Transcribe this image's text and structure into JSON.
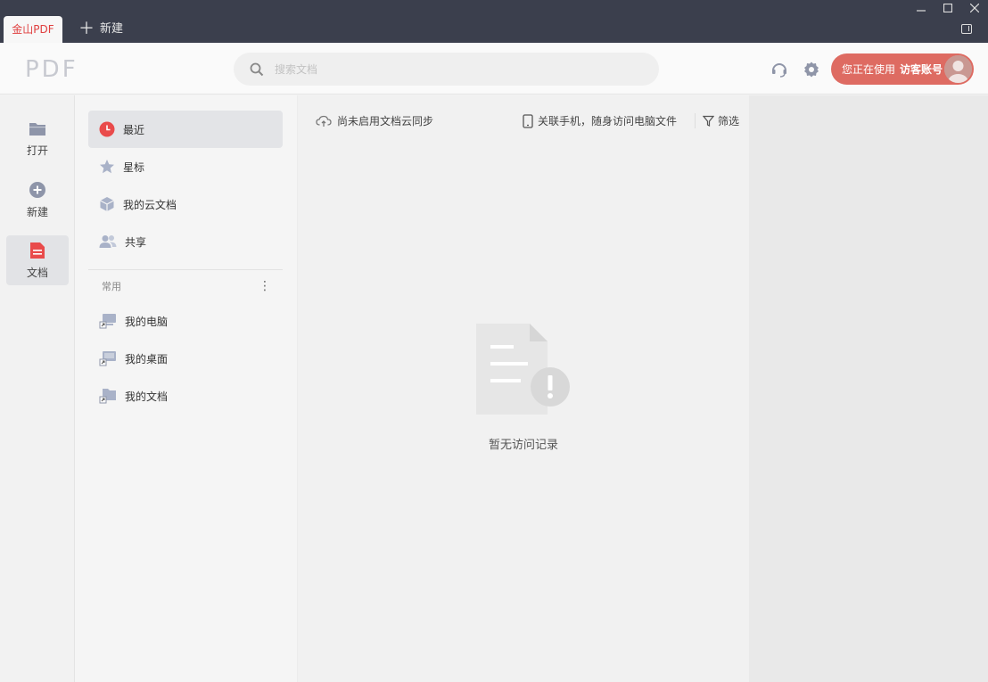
{
  "tabs": {
    "active_label": "金山PDF",
    "new_label": "新建"
  },
  "header": {
    "logo": "PDF",
    "search_placeholder": "搜索文档",
    "account_prefix": "您正在使用",
    "account_name": "访客账号"
  },
  "rail": {
    "items": [
      {
        "label": "打开",
        "icon": "folder-icon"
      },
      {
        "label": "新建",
        "icon": "plus-circle-icon"
      },
      {
        "label": "文档",
        "icon": "document-icon",
        "active": true
      }
    ]
  },
  "nav": {
    "items": [
      {
        "label": "最近",
        "icon": "clock-icon",
        "active": true
      },
      {
        "label": "星标",
        "icon": "star-icon"
      },
      {
        "label": "我的云文档",
        "icon": "cloud-box-icon"
      },
      {
        "label": "共享",
        "icon": "people-icon"
      }
    ],
    "section_label": "常用",
    "more_glyph": "⋮",
    "common": [
      {
        "label": "我的电脑",
        "icon": "computer-shortcut-icon"
      },
      {
        "label": "我的桌面",
        "icon": "desktop-shortcut-icon"
      },
      {
        "label": "我的文档",
        "icon": "folder-shortcut-icon"
      }
    ]
  },
  "main": {
    "sync_text": "尚未启用文档云同步",
    "phone_text": "关联手机，随身访问电脑文件",
    "filter_text": "筛选",
    "empty_text": "暂无访问记录"
  },
  "colors": {
    "accent_red": "#e04040",
    "account_button": "#de6b62",
    "titlebar": "#3b3f4d"
  }
}
